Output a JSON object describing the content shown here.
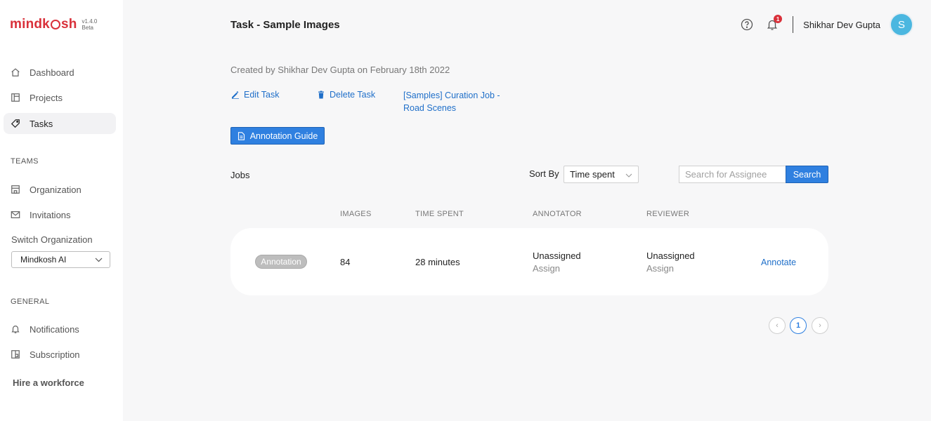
{
  "brand": {
    "name_left": "mindk",
    "name_right": "sh",
    "version": "v1.4.0",
    "stage": "Beta",
    "color": "#d9303a"
  },
  "sidebar": {
    "main_items": [
      {
        "label": "Dashboard",
        "icon": "home-icon"
      },
      {
        "label": "Projects",
        "icon": "projects-icon"
      },
      {
        "label": "Tasks",
        "icon": "tag-icon",
        "active": true
      }
    ],
    "teams_label": "TEAMS",
    "team_items": [
      {
        "label": "Organization",
        "icon": "building-icon"
      },
      {
        "label": "Invitations",
        "icon": "mail-icon"
      }
    ],
    "switch_label": "Switch Organization",
    "org_selected": "Mindkosh AI",
    "general_label": "GENERAL",
    "general_items": [
      {
        "label": "Notifications",
        "icon": "bell-icon"
      },
      {
        "label": "Subscription",
        "icon": "subscription-icon"
      }
    ],
    "hire_label": "Hire a workforce"
  },
  "header": {
    "title": "Task - Sample Images",
    "notification_count": "1",
    "user_name": "Shikhar Dev Gupta",
    "avatar_initial": "S",
    "avatar_color": "#4bb7e0"
  },
  "task": {
    "created_text": "Created by Shikhar Dev Gupta on February 18th 2022",
    "edit_label": "Edit Task",
    "delete_label": "Delete Task",
    "job_link": "[Samples] Curation Job - Road Scenes",
    "guide_label": "Annotation Guide"
  },
  "jobs": {
    "label": "Jobs",
    "sort_label": "Sort By",
    "sort_value": "Time spent",
    "search_placeholder": "Search for Assignee",
    "search_button": "Search",
    "columns": [
      "IMAGES",
      "TIME SPENT",
      "ANNOTATOR",
      "REVIEWER"
    ],
    "rows": [
      {
        "status": "Annotation",
        "images": "84",
        "time_spent": "28 minutes",
        "annotator": "Unassigned",
        "annotator_action": "Assign",
        "reviewer": "Unassigned",
        "reviewer_action": "Assign",
        "action": "Annotate"
      }
    ],
    "pagination": {
      "prev": "‹",
      "current": "1",
      "next": "›"
    }
  },
  "accent_color": "#2f80e0"
}
